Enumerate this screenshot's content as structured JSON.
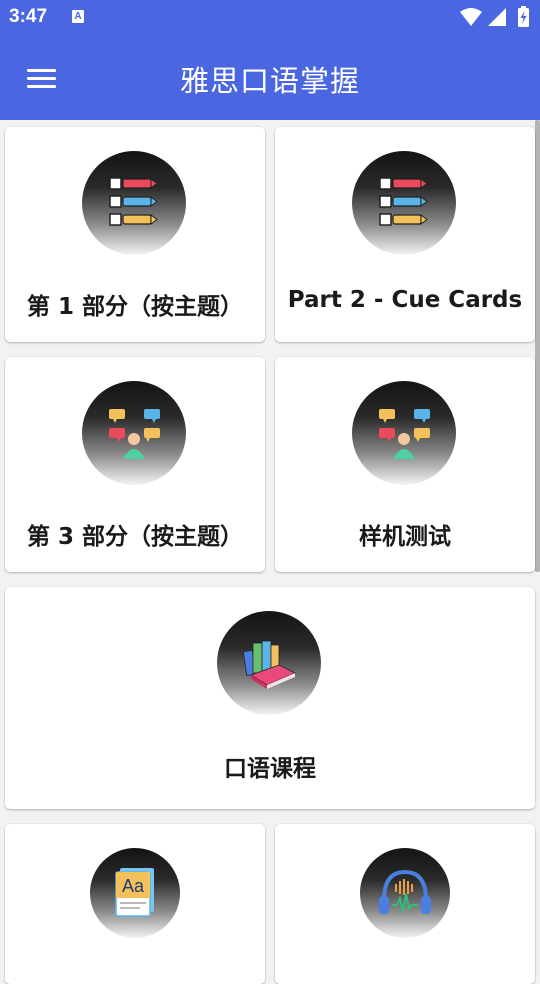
{
  "status_bar": {
    "time": "3:47",
    "notification_icon": "A"
  },
  "app_bar": {
    "title": "雅思口语掌握",
    "menu_icon": "hamburger-menu-icon"
  },
  "colors": {
    "primary": "#4a66e0",
    "card_background": "#ffffff",
    "page_background": "#f2f2f2"
  },
  "cards": [
    {
      "label": "第 1 部分（按主题）",
      "icon": "numbered-list-icon"
    },
    {
      "label": "Part 2 - Cue Cards",
      "icon": "numbered-list-icon"
    },
    {
      "label": "第 3 部分（按主题）",
      "icon": "conversation-person-icon"
    },
    {
      "label": "样机测试",
      "icon": "conversation-person-icon"
    },
    {
      "label": "口语课程",
      "icon": "books-icon"
    },
    {
      "label": "",
      "icon": "vocabulary-cards-icon"
    },
    {
      "label": "",
      "icon": "headphones-audio-icon"
    }
  ]
}
